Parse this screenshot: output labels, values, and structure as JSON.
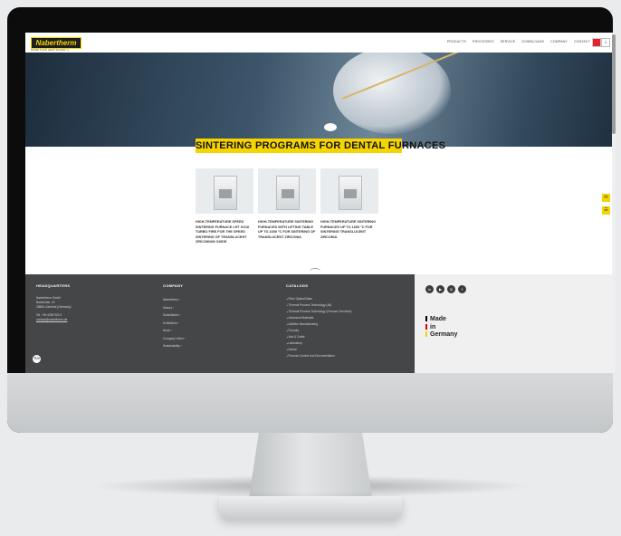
{
  "site": {
    "logo_text": "Nabertherm",
    "logo_sub": "MORE THAN HEAT 30-3000 °C",
    "nav_items": [
      "PRODUCTS",
      "PROCESSES",
      "SERVICE",
      "DOWNLOADS",
      "COMPANY",
      "CONTACT"
    ],
    "search_glyph": "⌕"
  },
  "hero": {
    "title": "SINTERING PROGRAMS FOR DENTAL FURNACES"
  },
  "products": [
    {
      "name": "HIGH-TEMPERATURE SPEED SINTERING FURNACE LHT 01/16 TURBO FIRE FOR THE SPEED SINTERING OF TRANSLUCENT ZIRCONIUM OXIDE"
    },
    {
      "name": "HIGH-TEMPERATURE SINTERING FURNACES WITH LIFTING TABLE UP TO 1650 °C FOR SINTERING OF TRANSLUCENT ZIRCONIA"
    },
    {
      "name": "HIGH-TEMPERATURE SINTERING FURNACES UP TO 1650 °C FOR SINTERING TRANSLUCENT ZIRCONIA"
    }
  ],
  "side_tabs": [
    "✉",
    "☰"
  ],
  "footer": {
    "hq": {
      "heading": "HEADQUARTERS",
      "lines": [
        "Nabertherm GmbH",
        "Bahnhofstr. 20",
        "28865 Lilienthal (Germany)"
      ],
      "phone": "Tel. +49 4298 922-0",
      "email": "contact@nabertherm.de"
    },
    "company": {
      "heading": "COMPANY",
      "links": [
        "Nabertherm ›",
        "History ›",
        "Subsidiaries ›",
        "Exhibitions ›",
        "News ›",
        "Company Video ›",
        "Sustainability ›"
      ]
    },
    "catalogs": {
      "heading": "CATALOGS",
      "items": [
        "Fiber Optics/Glass",
        "Thermal Process Technology (All)",
        "Thermal Process Technology (Furnace Overview)",
        "Advanced Materials",
        "Additive Manufacturing",
        "Foundry",
        "Arts & Crafts",
        "Laboratory",
        "Dental",
        "Process Control and Documentation"
      ]
    },
    "badge": "TÜV",
    "social": [
      "in",
      "▶",
      "◎",
      "f"
    ],
    "made_in": [
      "Made",
      "in",
      "Germany"
    ],
    "made_colors": [
      "#000000",
      "#dd0000",
      "#ffcc00"
    ]
  }
}
